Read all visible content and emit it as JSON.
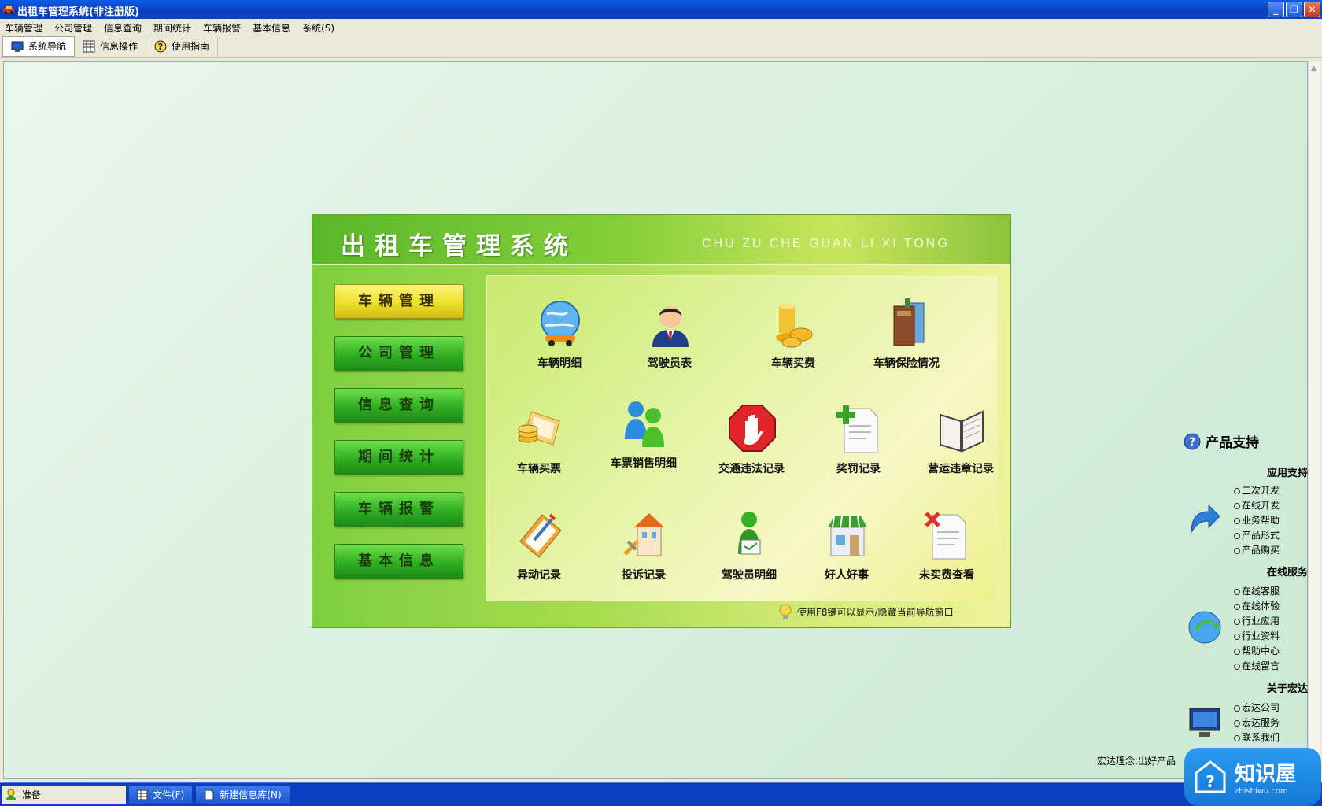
{
  "window": {
    "title": "出租车管理系统(非注册版)",
    "btn_min": "_",
    "btn_max": "❐",
    "btn_close": "✕"
  },
  "menu": [
    "车辆管理",
    "公司管理",
    "信息查询",
    "期间统计",
    "车辆报警",
    "基本信息",
    "系统(S)"
  ],
  "toolbar": {
    "nav": "系统导航",
    "info": "信息操作",
    "guide": "使用指南"
  },
  "panel": {
    "title": "出租车管理系统",
    "subtitle": "CHU ZU CHE GUAN LI XI TONG",
    "side_buttons": [
      "车辆管理",
      "公司管理",
      "信息查询",
      "期间统计",
      "车辆报警",
      "基本信息"
    ],
    "items": [
      "车辆明细",
      "驾驶员表",
      "车辆买费",
      "车辆保险情况",
      "车辆买票",
      "车票销售明细",
      "交通违法记录",
      "奖罚记录",
      "营运违章记录",
      "异动记录",
      "投诉记录",
      "驾驶员明细",
      "好人好事",
      "未买费查看"
    ],
    "tip": "使用F8键可以显示/隐藏当前导航窗口"
  },
  "support": {
    "title": "产品支持",
    "sections": [
      {
        "name": "应用支持",
        "links": [
          "二次开发",
          "在线开发",
          "业务帮助",
          "产品形式",
          "产品购买"
        ]
      },
      {
        "name": "在线服务",
        "links": [
          "在线客服",
          "在线体验",
          "行业应用",
          "行业资料",
          "帮助中心",
          "在线留言"
        ]
      },
      {
        "name": "关于宏达",
        "links": [
          "宏达公司",
          "宏达服务",
          "联系我们"
        ]
      }
    ],
    "motto": "宏达理念:出好产品"
  },
  "statusbar": {
    "ready": "准备",
    "task1": "文件(F)",
    "task2": "新建信息库(N)"
  },
  "watermark": {
    "main": "知识屋",
    "sub": "zhishiwu.com"
  }
}
